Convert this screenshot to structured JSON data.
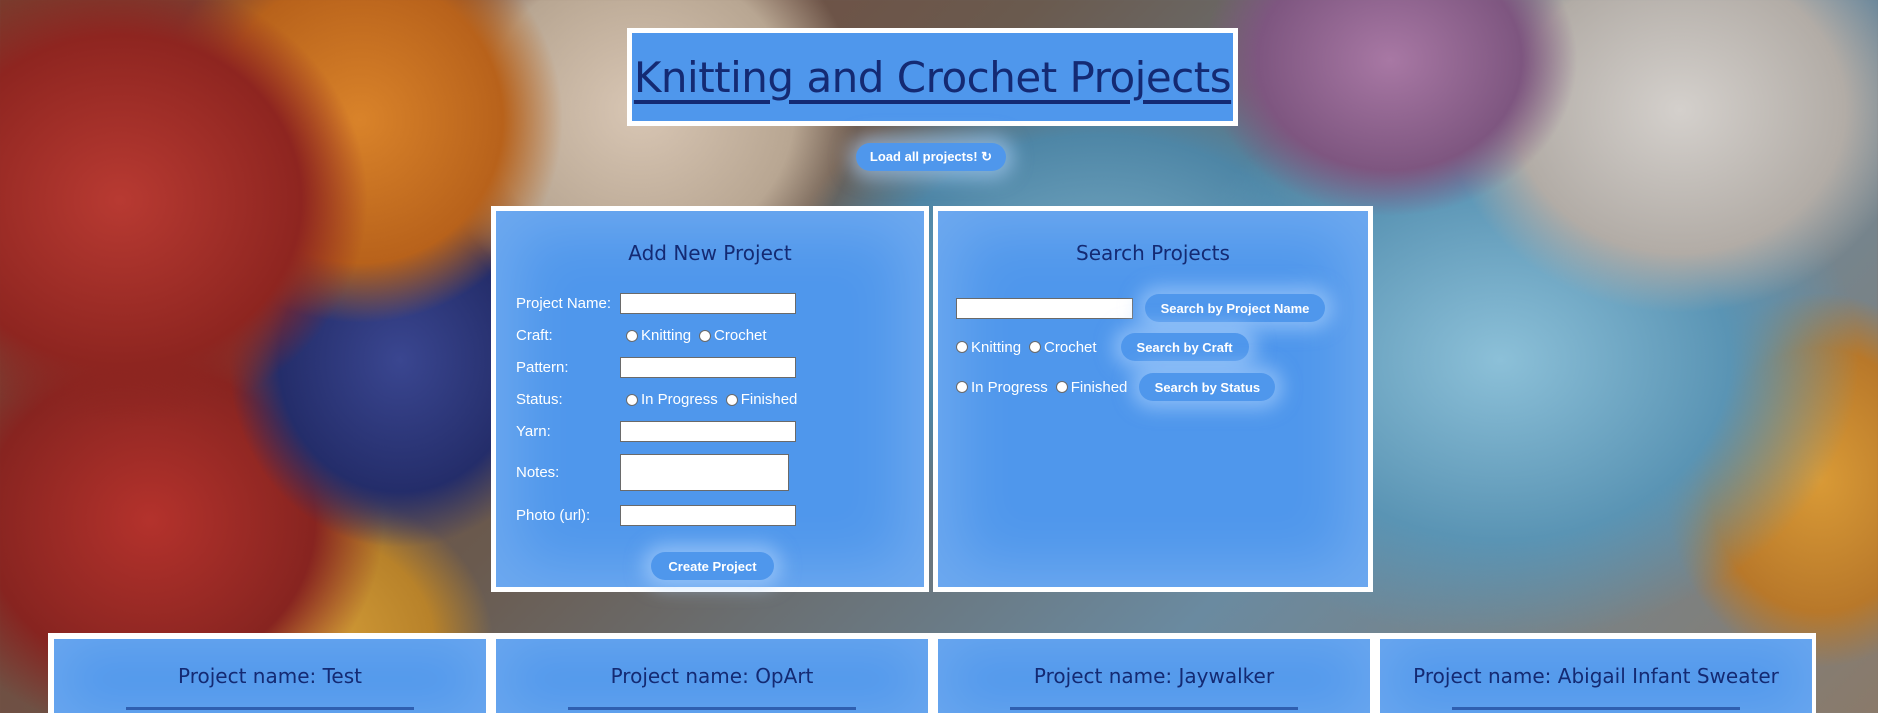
{
  "header": {
    "title": "Knitting and Crochet Projects"
  },
  "load_button": {
    "label": "Load all projects! ↻"
  },
  "add_panel": {
    "heading": "Add New Project",
    "fields": {
      "name_label": "Project Name:",
      "craft_label": "Craft:",
      "craft_options": [
        "Knitting",
        "Crochet"
      ],
      "pattern_label": "Pattern:",
      "status_label": "Status:",
      "status_options": [
        "In Progress",
        "Finished"
      ],
      "yarn_label": "Yarn:",
      "notes_label": "Notes:",
      "photo_label": "Photo (url):"
    },
    "create_label": "Create Project"
  },
  "search_panel": {
    "heading": "Search Projects",
    "by_name_label": "Search by Project Name",
    "craft_options": [
      "Knitting",
      "Crochet"
    ],
    "by_craft_label": "Search by Craft",
    "status_options": [
      "In Progress",
      "Finished"
    ],
    "by_status_label": "Search by Status"
  },
  "projects": [
    {
      "title": "Project name: Test"
    },
    {
      "title": "Project name: OpArt"
    },
    {
      "title": "Project name: Jaywalker"
    },
    {
      "title": "Project name: Abigail Infant Sweater"
    }
  ],
  "colors": {
    "panel": "#4f97ec",
    "heading": "#142a73",
    "border": "#ffffff"
  }
}
